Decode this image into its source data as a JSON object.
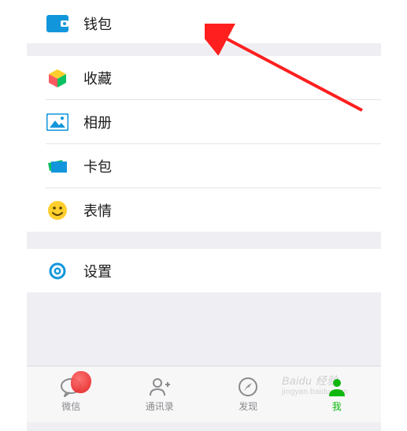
{
  "menu": {
    "wallet": {
      "label": "钱包",
      "icon": "wallet-icon"
    },
    "favorites": {
      "label": "收藏",
      "icon": "cube-icon"
    },
    "album": {
      "label": "相册",
      "icon": "photo-icon"
    },
    "cards": {
      "label": "卡包",
      "icon": "cards-icon"
    },
    "stickers": {
      "label": "表情",
      "icon": "smiley-icon"
    },
    "settings": {
      "label": "设置",
      "icon": "gear-icon"
    }
  },
  "tabs": {
    "chat": {
      "label": "微信"
    },
    "contacts": {
      "label": "通讯录"
    },
    "discover": {
      "label": "发现"
    },
    "me": {
      "label": "我"
    }
  },
  "watermark": {
    "main": "Baidu 经验",
    "sub": "jingyan.baidu.com"
  },
  "colors": {
    "accent": "#09bb07",
    "icon_blue": "#1296db",
    "icon_yellow": "#ffcf2d",
    "icon_green": "#08c160",
    "arrow": "#ff1f1f"
  }
}
